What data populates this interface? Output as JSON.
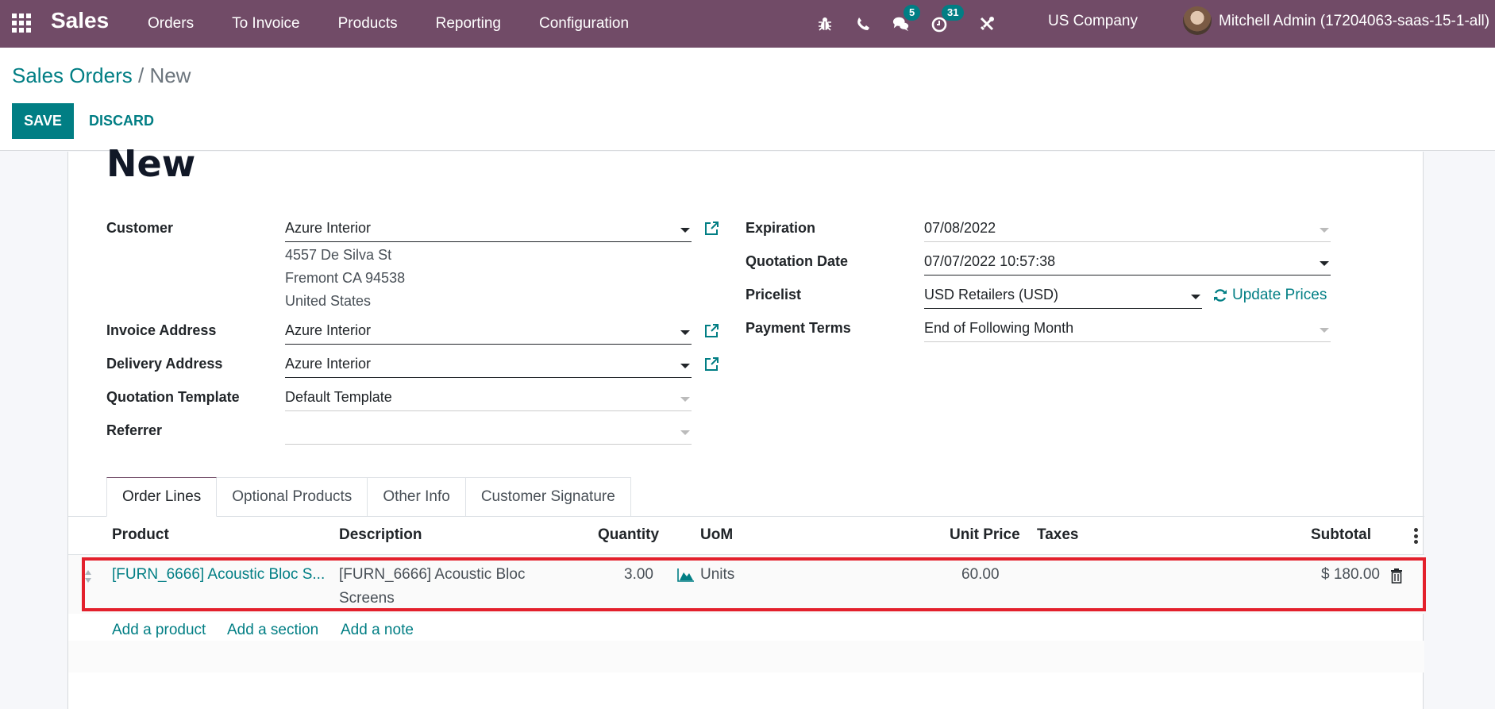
{
  "navbar": {
    "app_name": "Sales",
    "menu": [
      "Orders",
      "To Invoice",
      "Products",
      "Reporting",
      "Configuration"
    ],
    "systray": {
      "icons": [
        "bug-icon",
        "phone-icon",
        "chat-icon",
        "activity-clock-icon",
        "tools-icon"
      ],
      "messages_badge": "5",
      "activities_badge": "31"
    },
    "company": "US Company",
    "user": "Mitchell Admin (17204063-saas-15-1-all)"
  },
  "control_panel": {
    "breadcrumb": {
      "parent": "Sales Orders",
      "separator": "/",
      "current": "New"
    },
    "save_label": "SAVE",
    "discard_label": "DISCARD"
  },
  "form": {
    "title": "New",
    "left_fields": {
      "customer": {
        "label": "Customer",
        "value": "Azure Interior",
        "address": [
          "4557 De Silva St",
          "Fremont CA 94538",
          "United States"
        ]
      },
      "invoice_address": {
        "label": "Invoice Address",
        "value": "Azure Interior"
      },
      "delivery_address": {
        "label": "Delivery Address",
        "value": "Azure Interior"
      },
      "quotation_template": {
        "label": "Quotation Template",
        "value": "Default Template"
      },
      "referrer": {
        "label": "Referrer",
        "value": ""
      }
    },
    "right_fields": {
      "expiration": {
        "label": "Expiration",
        "value": "07/08/2022"
      },
      "quotation_date": {
        "label": "Quotation Date",
        "value": "07/07/2022 10:57:38"
      },
      "pricelist": {
        "label": "Pricelist",
        "value": "USD Retailers (USD)",
        "action": "Update Prices"
      },
      "payment_terms": {
        "label": "Payment Terms",
        "value": "End of Following Month"
      }
    }
  },
  "tabs": [
    {
      "label": "Order Lines",
      "active": true
    },
    {
      "label": "Optional Products",
      "active": false
    },
    {
      "label": "Other Info",
      "active": false
    },
    {
      "label": "Customer Signature",
      "active": false
    }
  ],
  "order_lines": {
    "columns": [
      "Product",
      "Description",
      "Quantity",
      "UoM",
      "Unit Price",
      "Taxes",
      "Subtotal"
    ],
    "rows": [
      {
        "product": "[FURN_6666] Acoustic Bloc S...",
        "description_line1": "[FURN_6666] Acoustic Bloc",
        "description_line2": "Screens",
        "quantity": "3.00",
        "uom": "Units",
        "unit_price": "60.00",
        "taxes": "",
        "subtotal": "$ 180.00"
      }
    ],
    "add_links": [
      "Add a product",
      "Add a section",
      "Add a note"
    ]
  },
  "colors": {
    "navbar": "#714B67",
    "primary": "#017e84",
    "highlight_box": "#e3202c"
  }
}
